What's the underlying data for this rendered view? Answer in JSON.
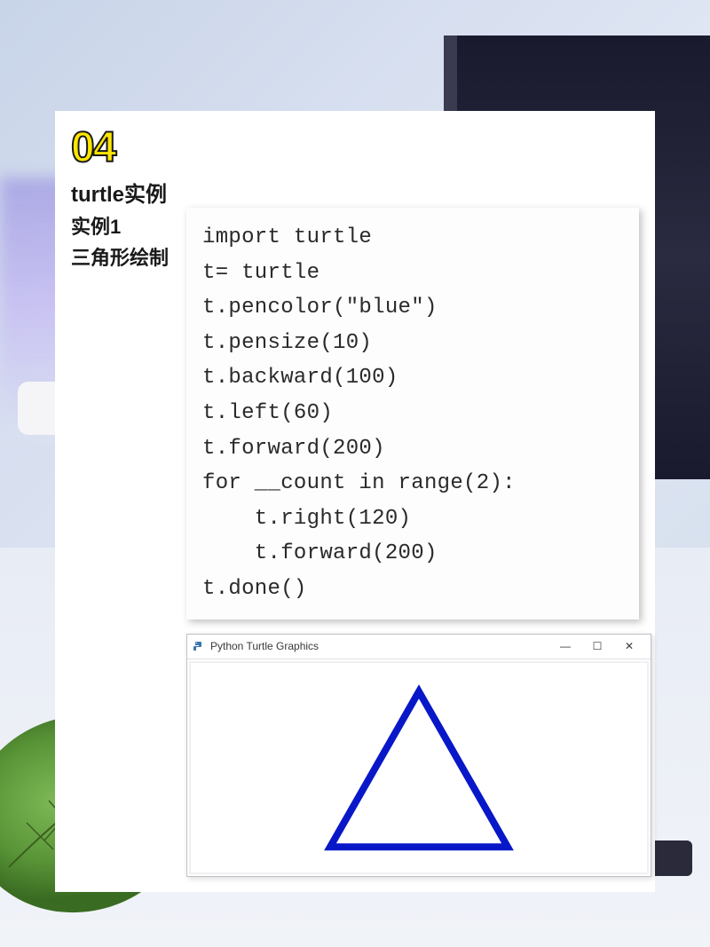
{
  "page_number": "04",
  "title": "turtle实例",
  "subtitle1": "实例1",
  "subtitle2": "三角形绘制",
  "code": "import turtle\nt= turtle\nt.pencolor(\"blue\")\nt.pensize(10)\nt.backward(100)\nt.left(60)\nt.forward(200)\nfor __count in range(2):\n    t.right(120)\n    t.forward(200)\nt.done()",
  "output_window": {
    "title": "Python Turtle Graphics",
    "minimize": "—",
    "maximize": "☐",
    "close": "✕"
  },
  "triangle": {
    "stroke": "#0818c8",
    "stroke_width": 8
  }
}
